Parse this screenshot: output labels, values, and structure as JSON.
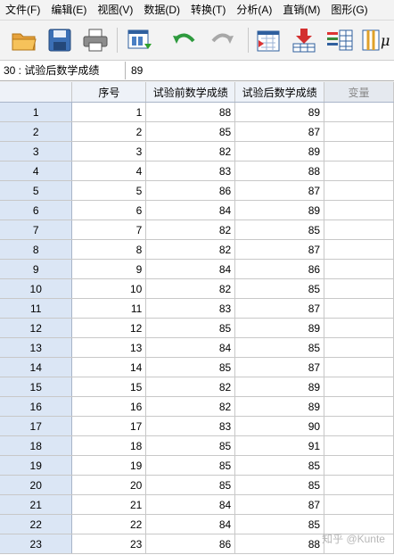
{
  "menu": [
    "文件(F)",
    "编辑(E)",
    "视图(V)",
    "数据(D)",
    "转换(T)",
    "分析(A)",
    "直销(M)",
    "图形(G)"
  ],
  "toolbar_icons": [
    "open-folder-icon",
    "save-icon",
    "print-icon",
    "dialog-recall-icon",
    "undo-icon",
    "redo-icon",
    "goto-case-icon",
    "goto-variable-icon",
    "variables-icon",
    "descriptive-statistics-icon"
  ],
  "cell_editor": {
    "reference": "30 : 试验后数学成绩",
    "value": "89"
  },
  "columns": [
    "序号",
    "试验前数学成绩",
    "试验后数学成绩",
    "变量"
  ],
  "rows": [
    {
      "n": "1",
      "id": "1",
      "pre": "88",
      "post": "89"
    },
    {
      "n": "2",
      "id": "2",
      "pre": "85",
      "post": "87"
    },
    {
      "n": "3",
      "id": "3",
      "pre": "82",
      "post": "89"
    },
    {
      "n": "4",
      "id": "4",
      "pre": "83",
      "post": "88"
    },
    {
      "n": "5",
      "id": "5",
      "pre": "86",
      "post": "87"
    },
    {
      "n": "6",
      "id": "6",
      "pre": "84",
      "post": "89"
    },
    {
      "n": "7",
      "id": "7",
      "pre": "82",
      "post": "85"
    },
    {
      "n": "8",
      "id": "8",
      "pre": "82",
      "post": "87"
    },
    {
      "n": "9",
      "id": "9",
      "pre": "84",
      "post": "86"
    },
    {
      "n": "10",
      "id": "10",
      "pre": "82",
      "post": "85"
    },
    {
      "n": "11",
      "id": "11",
      "pre": "83",
      "post": "87"
    },
    {
      "n": "12",
      "id": "12",
      "pre": "85",
      "post": "89"
    },
    {
      "n": "13",
      "id": "13",
      "pre": "84",
      "post": "85"
    },
    {
      "n": "14",
      "id": "14",
      "pre": "85",
      "post": "87"
    },
    {
      "n": "15",
      "id": "15",
      "pre": "82",
      "post": "89"
    },
    {
      "n": "16",
      "id": "16",
      "pre": "82",
      "post": "89"
    },
    {
      "n": "17",
      "id": "17",
      "pre": "83",
      "post": "90"
    },
    {
      "n": "18",
      "id": "18",
      "pre": "85",
      "post": "91"
    },
    {
      "n": "19",
      "id": "19",
      "pre": "85",
      "post": "85"
    },
    {
      "n": "20",
      "id": "20",
      "pre": "85",
      "post": "85"
    },
    {
      "n": "21",
      "id": "21",
      "pre": "84",
      "post": "87"
    },
    {
      "n": "22",
      "id": "22",
      "pre": "84",
      "post": "85"
    },
    {
      "n": "23",
      "id": "23",
      "pre": "86",
      "post": "88"
    }
  ],
  "watermark": "知乎 @Kunte"
}
